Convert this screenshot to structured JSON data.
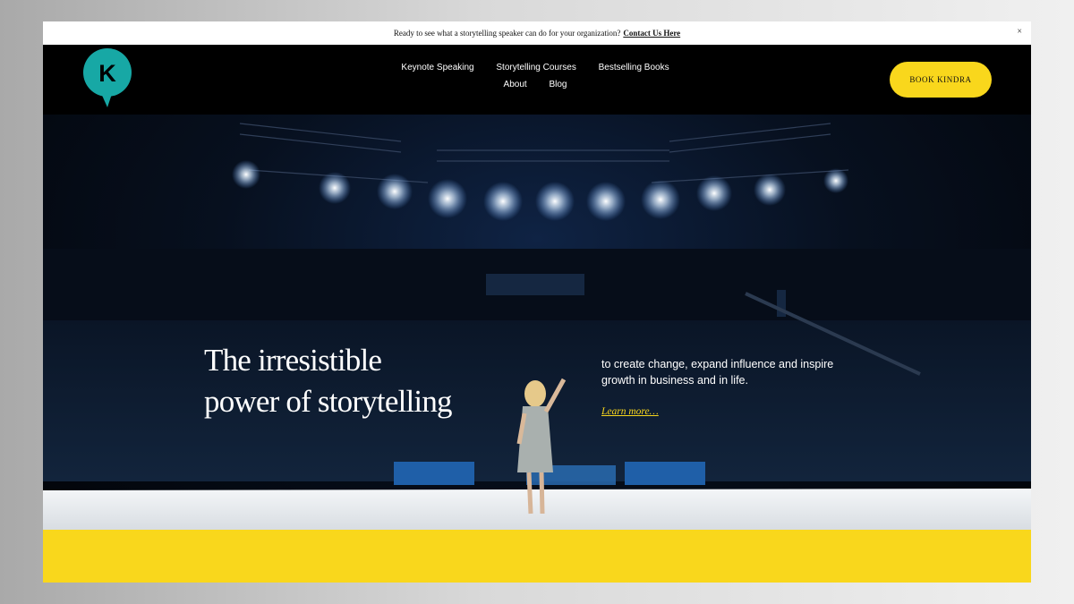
{
  "announcement": {
    "text": "Ready to see what a storytelling speaker can do for your organization?",
    "link": "Contact Us Here",
    "close": "×"
  },
  "header": {
    "logo_letter": "K",
    "nav": [
      "Keynote Speaking",
      "Storytelling Courses",
      "Bestselling Books",
      "About",
      "Blog"
    ],
    "cta": "BOOK KINDRA"
  },
  "hero": {
    "headline_line1": "The irresistible",
    "headline_line2": "power of storytelling",
    "subtext": "to create change, expand influence and inspire growth in business and in life.",
    "learn_more": "Learn more…"
  },
  "colors": {
    "accent_yellow": "#f9d71c",
    "logo_teal": "#17a8a5",
    "background": "#000000"
  }
}
